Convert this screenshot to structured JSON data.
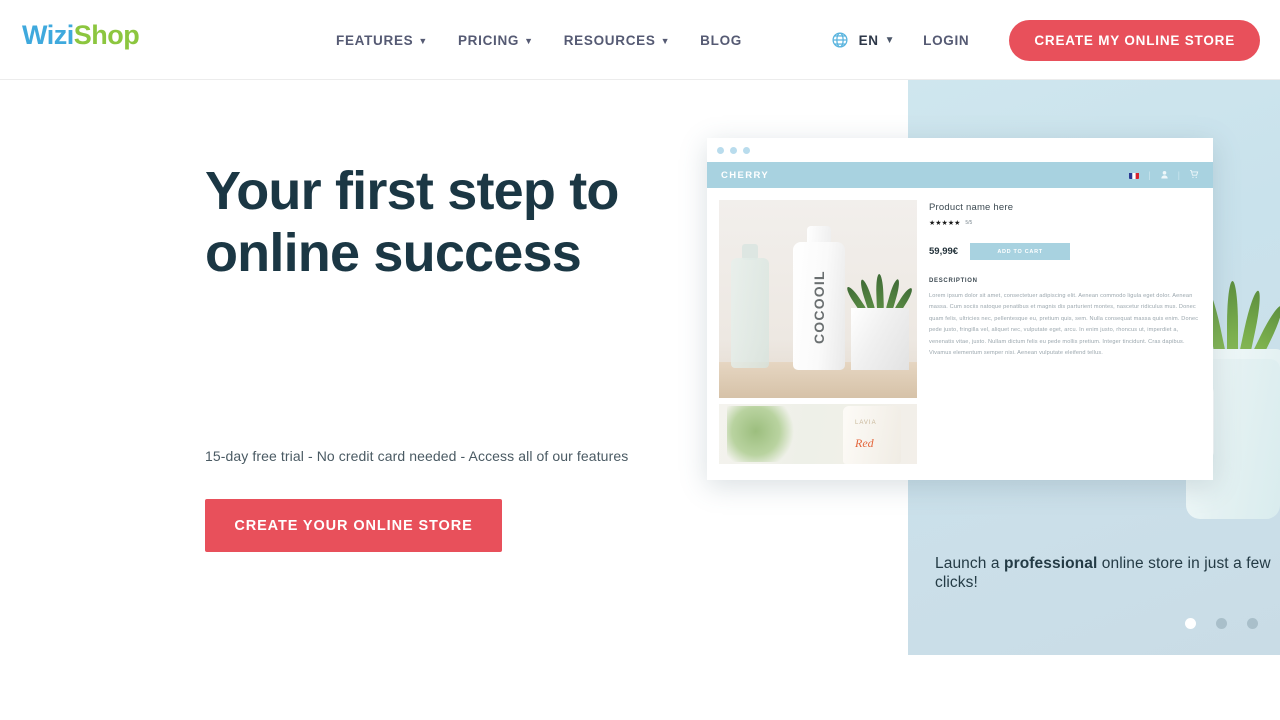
{
  "header": {
    "logo": {
      "part1": "Wizi",
      "part2": "Shop",
      "color1": "#3fa9dd",
      "color2": "#8cc63f"
    },
    "nav": [
      {
        "label": "FEATURES",
        "has_dropdown": true
      },
      {
        "label": "PRICING",
        "has_dropdown": true
      },
      {
        "label": "RESOURCES",
        "has_dropdown": true
      },
      {
        "label": "BLOG",
        "has_dropdown": false
      }
    ],
    "language": {
      "code": "EN",
      "icon": "globe-icon"
    },
    "login_label": "LOGIN",
    "cta_label": "CREATE MY ONLINE STORE",
    "cta_color": "#e8505b"
  },
  "hero": {
    "title": "Your first step to online success",
    "subtitle": "15-day free trial - No credit card needed - Access all of our features",
    "cta_label": "CREATE YOUR ONLINE STORE",
    "cta_color": "#e8505b",
    "title_color": "#1b3744"
  },
  "mockup": {
    "browser_dots": 3,
    "shop_name": "CHERRY",
    "shop_bar_color": "#a8d2e0",
    "shop_icons": [
      "flag-fr-icon",
      "user-icon",
      "cart-icon"
    ],
    "product": {
      "name": "Product name here",
      "stars": "★★★★★",
      "rating": "5/5",
      "price": "59,99€",
      "add_to_cart_label": "ADD TO CART",
      "description_heading": "DESCRIPTION",
      "description_body": "Lorem ipsum dolor sit amet, consectetuer adipiscing elit. Aenean commodo ligula eget dolor. Aenean massa. Cum sociis natoque penatibus et magnis dis parturient montes, nascetur ridiculus mus. Donec quam felis, ultricies nec, pellentesque eu, pretium quis, sem. Nulla consequat massa quis enim. Donec pede justo, fringilla vel, aliquet nec, vulputate eget, arcu. In enim justo, rhoncus ut, imperdiet a, venenatis vitae, justo. Nullam dictum felis eu pede mollis pretium. Integer tincidunt. Cras dapibus. Vivamus elementum semper nisi. Aenean vulputate eleifend tellus.",
      "image1_brand": "COCOOIL",
      "image2_brand": "LAVIA",
      "image2_text": "Red"
    }
  },
  "panel": {
    "caption_before": "Launch a ",
    "caption_bold": "professional",
    "caption_after": " online store in just a few clicks!",
    "background_color": "#c9e2ec",
    "dots": [
      {
        "active": true
      },
      {
        "active": false
      },
      {
        "active": false
      }
    ]
  }
}
